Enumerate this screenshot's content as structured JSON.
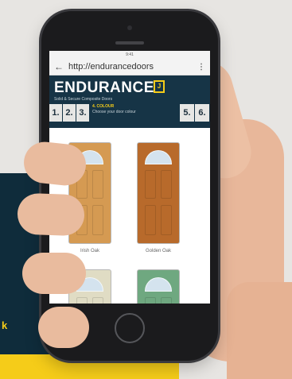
{
  "browser": {
    "url": "http://endurancedoors",
    "status_time": "9:41",
    "back_glyph": "←",
    "menu_glyph": "⋮"
  },
  "site": {
    "logo": "ENDURANCE",
    "logo_mark": "J",
    "tagline": "Solid & Secure Composite Doors",
    "steps_left": [
      "1.",
      "2.",
      "3."
    ],
    "active_step": {
      "label": "4. COLOUR",
      "subtitle": "Choose your door colour"
    },
    "steps_right": [
      "5.",
      "6."
    ]
  },
  "doors": [
    {
      "caption": "Irish Oak",
      "color": "#d59a52"
    },
    {
      "caption": "Golden Oak",
      "color": "#b86a2b"
    },
    {
      "caption": "",
      "color": "#e0dcc4"
    },
    {
      "caption": "",
      "color": "#6fa880"
    }
  ],
  "background": {
    "word": "k",
    "colors": {
      "navy": "#0f2c3b",
      "yellow": "#f5cc19",
      "wall": "#e7e5e2"
    }
  }
}
